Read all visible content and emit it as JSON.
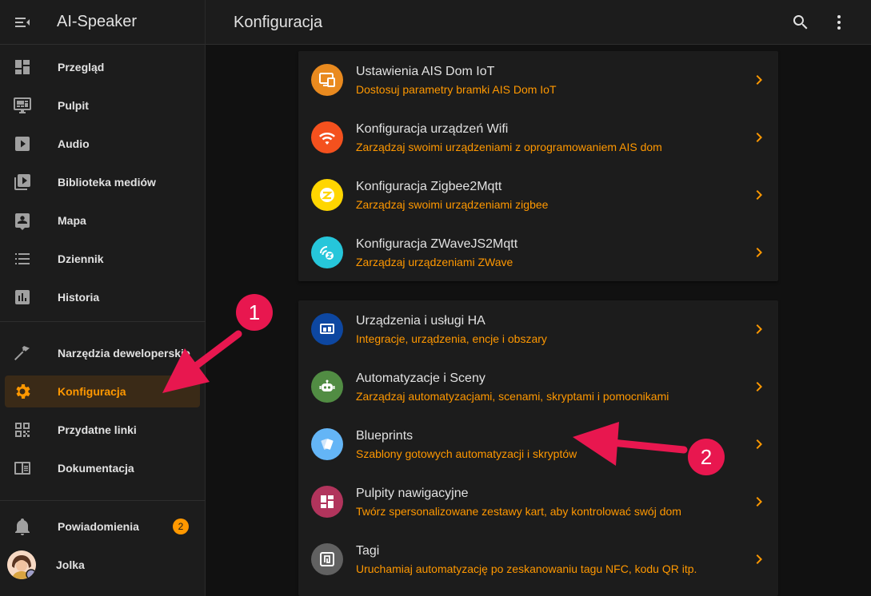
{
  "sidebar": {
    "title": "AI-Speaker",
    "items": [
      {
        "label": "Przegląd",
        "icon": "dashboard-icon"
      },
      {
        "label": "Pulpit",
        "icon": "monitor-dashboard-icon"
      },
      {
        "label": "Audio",
        "icon": "play-box-icon"
      },
      {
        "label": "Biblioteka mediów",
        "icon": "media-library-icon"
      },
      {
        "label": "Mapa",
        "icon": "map-account-icon"
      },
      {
        "label": "Dziennik",
        "icon": "format-list-checks-icon"
      },
      {
        "label": "Historia",
        "icon": "chart-box-icon"
      }
    ],
    "dev_items": [
      {
        "label": "Narzędzia deweloperskie",
        "icon": "hammer-icon"
      },
      {
        "label": "Konfiguracja",
        "icon": "cog-icon",
        "active": true
      },
      {
        "label": "Przydatne linki",
        "icon": "qrcode-icon"
      },
      {
        "label": "Dokumentacja",
        "icon": "book-open-icon"
      }
    ],
    "notifications": {
      "label": "Powiadomienia",
      "count": "2"
    },
    "user": {
      "name": "Jolka"
    }
  },
  "header": {
    "title": "Konfiguracja"
  },
  "cards": [
    {
      "rows": [
        {
          "title": "Ustawienia AIS Dom IoT",
          "subtitle": "Dostosuj parametry bramki AIS Dom IoT",
          "color": "#e98a1f",
          "icon": "ais-iot-icon"
        },
        {
          "title": "Konfiguracja urządzeń Wifi",
          "subtitle": "Zarządzaj swoimi urządzeniami z oprogramowaniem AIS dom",
          "color": "#f4511e",
          "icon": "wifi-icon"
        },
        {
          "title": "Konfiguracja Zigbee2Mqtt",
          "subtitle": "Zarządzaj swoimi urządzeniami zigbee",
          "color": "#ffd600",
          "icon": "zigbee-icon"
        },
        {
          "title": "Konfiguracja ZWaveJS2Mqtt",
          "subtitle": "Zarządzaj urządzeniami ZWave",
          "color": "#26c6da",
          "icon": "zwave-icon"
        }
      ]
    },
    {
      "rows": [
        {
          "title": "Urządzenia i usługi HA",
          "subtitle": "Integracje, urządzenia, encje i obszary",
          "color": "#0d47a1",
          "icon": "devices-icon"
        },
        {
          "title": "Automatyzacje i Sceny",
          "subtitle": "Zarządzaj automatyzacjami, scenami, skryptami i pomocnikami",
          "color": "#518c43",
          "icon": "robot-icon"
        },
        {
          "title": "Blueprints",
          "subtitle": "Szablony gotowych automatyzacji i skryptów",
          "color": "#64b5f6",
          "icon": "blueprint-icon"
        },
        {
          "title": "Pulpity nawigacyjne",
          "subtitle": "Twórz spersonalizowane zestawy kart, aby kontrolować swój dom",
          "color": "#b1345c",
          "icon": "view-dashboard-icon"
        },
        {
          "title": "Tagi",
          "subtitle": "Uruchamiaj automatyzację po zeskanowaniu tagu NFC, kodu QR itp.",
          "color": "#616161",
          "icon": "nfc-tag-icon"
        }
      ]
    }
  ],
  "annotations": {
    "callout_1": "1",
    "callout_2": "2",
    "color": "#e8174f"
  },
  "colors": {
    "accent": "#ff9800",
    "background": "#111111",
    "card": "#1c1c1c"
  }
}
